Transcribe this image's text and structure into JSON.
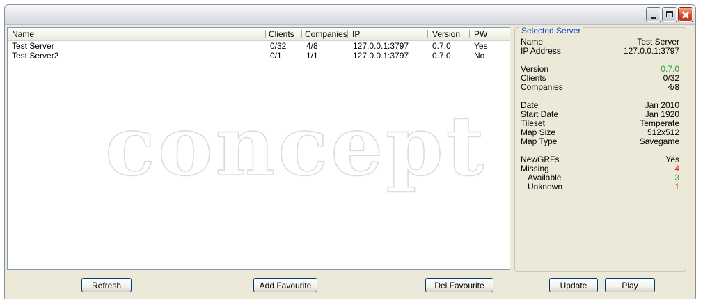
{
  "window": {
    "title": ""
  },
  "server_list": {
    "columns": {
      "name": "Name",
      "clients": "Clients",
      "companies": "Companies",
      "ip": "IP",
      "version": "Version",
      "pw": "PW"
    },
    "rows": [
      {
        "name": "Test Server",
        "clients": "0/32",
        "companies": "4/8",
        "ip": "127.0.0.1:3797",
        "version": "0.7.0",
        "pw": "Yes"
      },
      {
        "name": "Test Server2",
        "clients": "0/1",
        "companies": "1/1",
        "ip": "127.0.0.1:3797",
        "version": "0.7.0",
        "pw": "No"
      }
    ],
    "watermark": "concept"
  },
  "selected_server": {
    "legend": "Selected Server",
    "name_label": "Name",
    "name_value": "Test Server",
    "ip_label": "IP Address",
    "ip_value": "127.0.0.1:3797",
    "version_label": "Version",
    "version_value": "0.7.0",
    "clients_label": "Clients",
    "clients_value": "0/32",
    "companies_label": "Companies",
    "companies_value": "4/8",
    "date_label": "Date",
    "date_value": "Jan 2010",
    "start_date_label": "Start Date",
    "start_date_value": "Jan 1920",
    "tileset_label": "Tileset",
    "tileset_value": "Temperate",
    "map_size_label": "Map Size",
    "map_size_value": "512x512",
    "map_type_label": "Map Type",
    "map_type_value": "Savegame",
    "newgrfs_label": "NewGRFs",
    "newgrfs_value": "Yes",
    "missing_label": "Missing",
    "missing_value": "4",
    "available_label": "Available",
    "available_value": "3",
    "unknown_label": "Unknown",
    "unknown_value": "1"
  },
  "buttons": {
    "refresh": "Refresh",
    "add_favourite": "Add Favourite",
    "del_favourite": "Del Favourite",
    "update": "Update",
    "play": "Play"
  },
  "colors": {
    "ok_green": "#26a03a",
    "warn_red": "#e02020",
    "legend_blue": "#0046d5"
  }
}
